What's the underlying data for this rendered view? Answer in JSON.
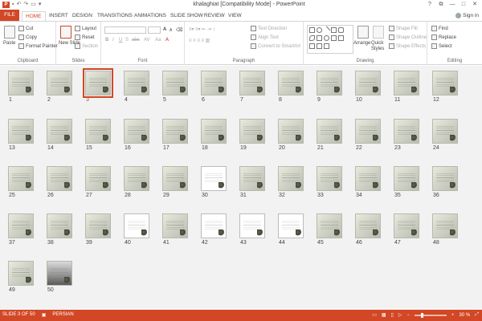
{
  "window": {
    "title": "khalaghiat [Compatibility Mode] - PowerPoint",
    "app_icon": "P",
    "sign_in": "Sign in",
    "controls": [
      "?",
      "—",
      "□",
      "✕"
    ]
  },
  "tabs": {
    "file": "FILE",
    "items": [
      "HOME",
      "INSERT",
      "DESIGN",
      "TRANSITIONS",
      "ANIMATIONS",
      "SLIDE SHOW",
      "REVIEW",
      "VIEW"
    ],
    "active": "HOME"
  },
  "ribbon": {
    "clipboard": {
      "label": "Clipboard",
      "paste": "Paste",
      "cut": "Cut",
      "copy": "Copy",
      "format_painter": "Format Painter"
    },
    "slides": {
      "label": "Slides",
      "new_slide": "New Slide",
      "layout": "Layout",
      "reset": "Reset",
      "section": "Section"
    },
    "font": {
      "label": "Font",
      "size_up": "A",
      "size_down": "A",
      "bold": "B",
      "italic": "I",
      "underline": "U",
      "strike": "S",
      "shadow": "abc",
      "spacing": "AV",
      "case": "Aa",
      "color": "A"
    },
    "paragraph": {
      "label": "Paragraph",
      "text_direction": "Text Direction",
      "align_text": "Align Text",
      "convert_smartart": "Convert to SmartArt"
    },
    "drawing": {
      "label": "Drawing",
      "arrange": "Arrange",
      "quick_styles": "Quick Styles",
      "shape_fill": "Shape Fill",
      "shape_outline": "Shape Outline",
      "shape_effects": "Shape Effects"
    },
    "editing": {
      "label": "Editing",
      "find": "Find",
      "replace": "Replace",
      "select": "Select"
    }
  },
  "slides": [
    "1",
    "2",
    "3",
    "4",
    "5",
    "6",
    "7",
    "8",
    "9",
    "10",
    "11",
    "12",
    "13",
    "14",
    "15",
    "16",
    "17",
    "18",
    "19",
    "20",
    "21",
    "22",
    "23",
    "24",
    "25",
    "26",
    "27",
    "28",
    "29",
    "30",
    "31",
    "32",
    "33",
    "34",
    "35",
    "36",
    "37",
    "38",
    "39",
    "40",
    "41",
    "42",
    "43",
    "44",
    "45",
    "46",
    "47",
    "48",
    "49",
    "50"
  ],
  "selected_slide": "3",
  "status": {
    "slide_info": "SLIDE 3 OF 50",
    "language": "PERSIAN",
    "zoom": "30 %"
  },
  "colors": {
    "accent": "#d24726",
    "sorter_bg": "#f2f2f2"
  }
}
